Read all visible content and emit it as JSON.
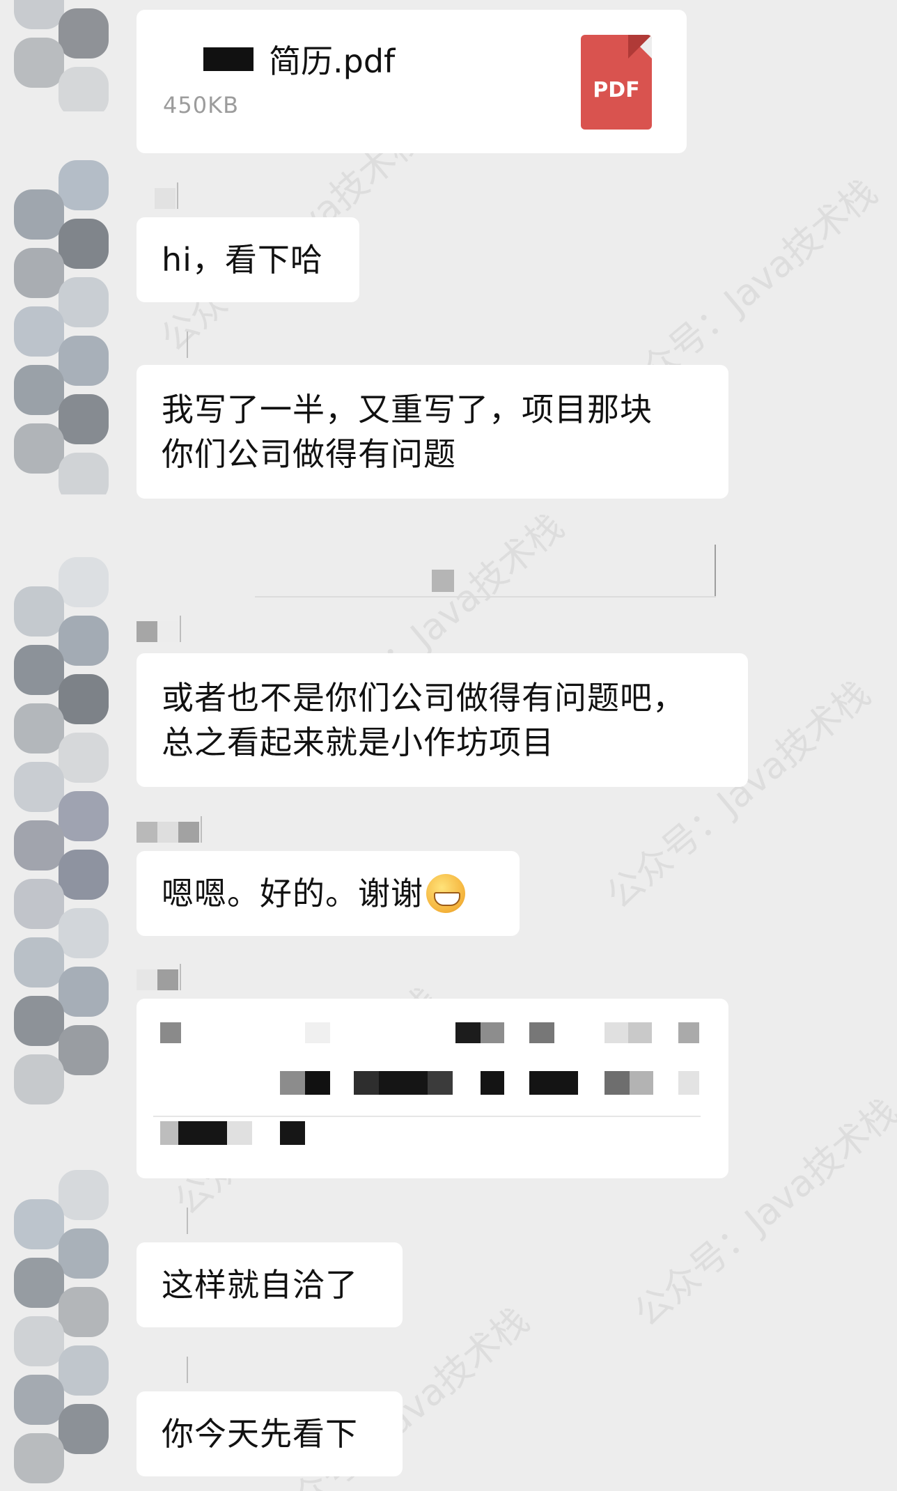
{
  "file_message": {
    "name_suffix": "简历.pdf",
    "size": "450KB",
    "icon_label": "PDF"
  },
  "messages": [
    {
      "lines": [
        "hi，看下哈"
      ]
    },
    {
      "lines": [
        "我写了一半，又重写了，项目那块",
        "你们公司做得有问题"
      ]
    },
    {
      "lines": [
        "或者也不是你们公司做得有问题吧，",
        "总之看起来就是小作坊项目"
      ]
    },
    {
      "lines": [
        "嗯嗯。好的。谢谢"
      ],
      "emoji": "grinning-face-icon"
    },
    {
      "lines": [
        "这样就自洽了"
      ]
    },
    {
      "lines": [
        "你今天先看下"
      ]
    }
  ],
  "watermark_text": "公众号：Java技术栈",
  "colors": {
    "background": "#ededed",
    "bubble": "#ffffff",
    "pdf_red": "#d9534f"
  }
}
